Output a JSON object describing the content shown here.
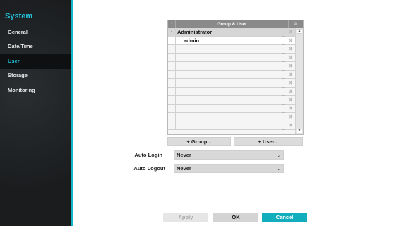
{
  "sidebar": {
    "title": "System",
    "items": [
      {
        "label": "General"
      },
      {
        "label": "Date/Time"
      },
      {
        "label": "User"
      },
      {
        "label": "Storage"
      },
      {
        "label": "Monitoring"
      }
    ],
    "active_index": 2
  },
  "table": {
    "sort_glyph": "•",
    "header": "Group & User",
    "delete_glyph": "✖",
    "rows": [
      {
        "toggle": "-",
        "name": "Administrator",
        "kind": "group"
      },
      {
        "toggle": "",
        "name": "admin",
        "kind": "user"
      }
    ],
    "empty_rows": 10,
    "row_edit_glyph": "_",
    "row_delete_glyph": "✖",
    "scroll_up": "▲",
    "scroll_down": "▼"
  },
  "buttons": {
    "add_group": "+ Group...",
    "add_user": "+ User..."
  },
  "form": {
    "auto_login_label": "Auto Login",
    "auto_login_value": "Never",
    "auto_logout_label": "Auto Logout",
    "auto_logout_value": "Never",
    "caret": "⌄"
  },
  "footer": {
    "apply": "Apply",
    "ok": "OK",
    "cancel": "Cancel"
  },
  "colors": {
    "accent": "#13b5c8",
    "sidebar_bg": "#1e2124",
    "cancel_bg": "#12aebd"
  }
}
